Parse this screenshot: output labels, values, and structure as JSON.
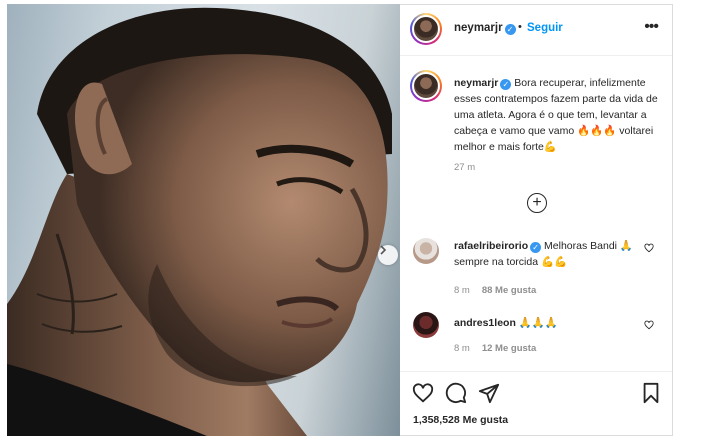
{
  "post": {
    "username": "neymarjr",
    "follow_label": "Seguir",
    "dot": "•",
    "more_label": "•••",
    "caption_prefix": "Bora recuperar, infelizmente esses contratempos fazem parte da vida de uma atleta. Agora é o que tem, levantar a cabeça e vamo que vamo ",
    "caption_mid": "",
    "caption_suffix": " voltarei melhor e mais forte",
    "caption_time": "27 m",
    "likes_text": "1,358,528 Me gusta"
  },
  "comments": [
    {
      "username": "rafaelribeirorio",
      "verified": true,
      "text_prefix": "Melhoras Bandi ",
      "text_suffix": " sempre na torcida ",
      "time": "8 m",
      "likes": "88 Me gusta"
    },
    {
      "username": "andres1leon",
      "verified": false,
      "text_prefix": "",
      "text_suffix": "",
      "time": "8 m",
      "likes": "12 Me gusta"
    }
  ],
  "colors": {
    "accent": "#0095f6",
    "verified": "#3897f0",
    "text": "#262626",
    "muted": "#8e8e8e",
    "border": "#dbdbdb"
  },
  "icons": {
    "verified": "verified-badge-icon",
    "add_comment": "plus-circle-icon",
    "like": "heart-icon",
    "comment": "comment-bubble-icon",
    "share": "paper-plane-icon",
    "save": "bookmark-icon",
    "next": "chevron-right-icon",
    "fire": "fire-emoji",
    "pray": "praying-hands-emoji",
    "muscle": "flexed-biceps-emoji"
  }
}
